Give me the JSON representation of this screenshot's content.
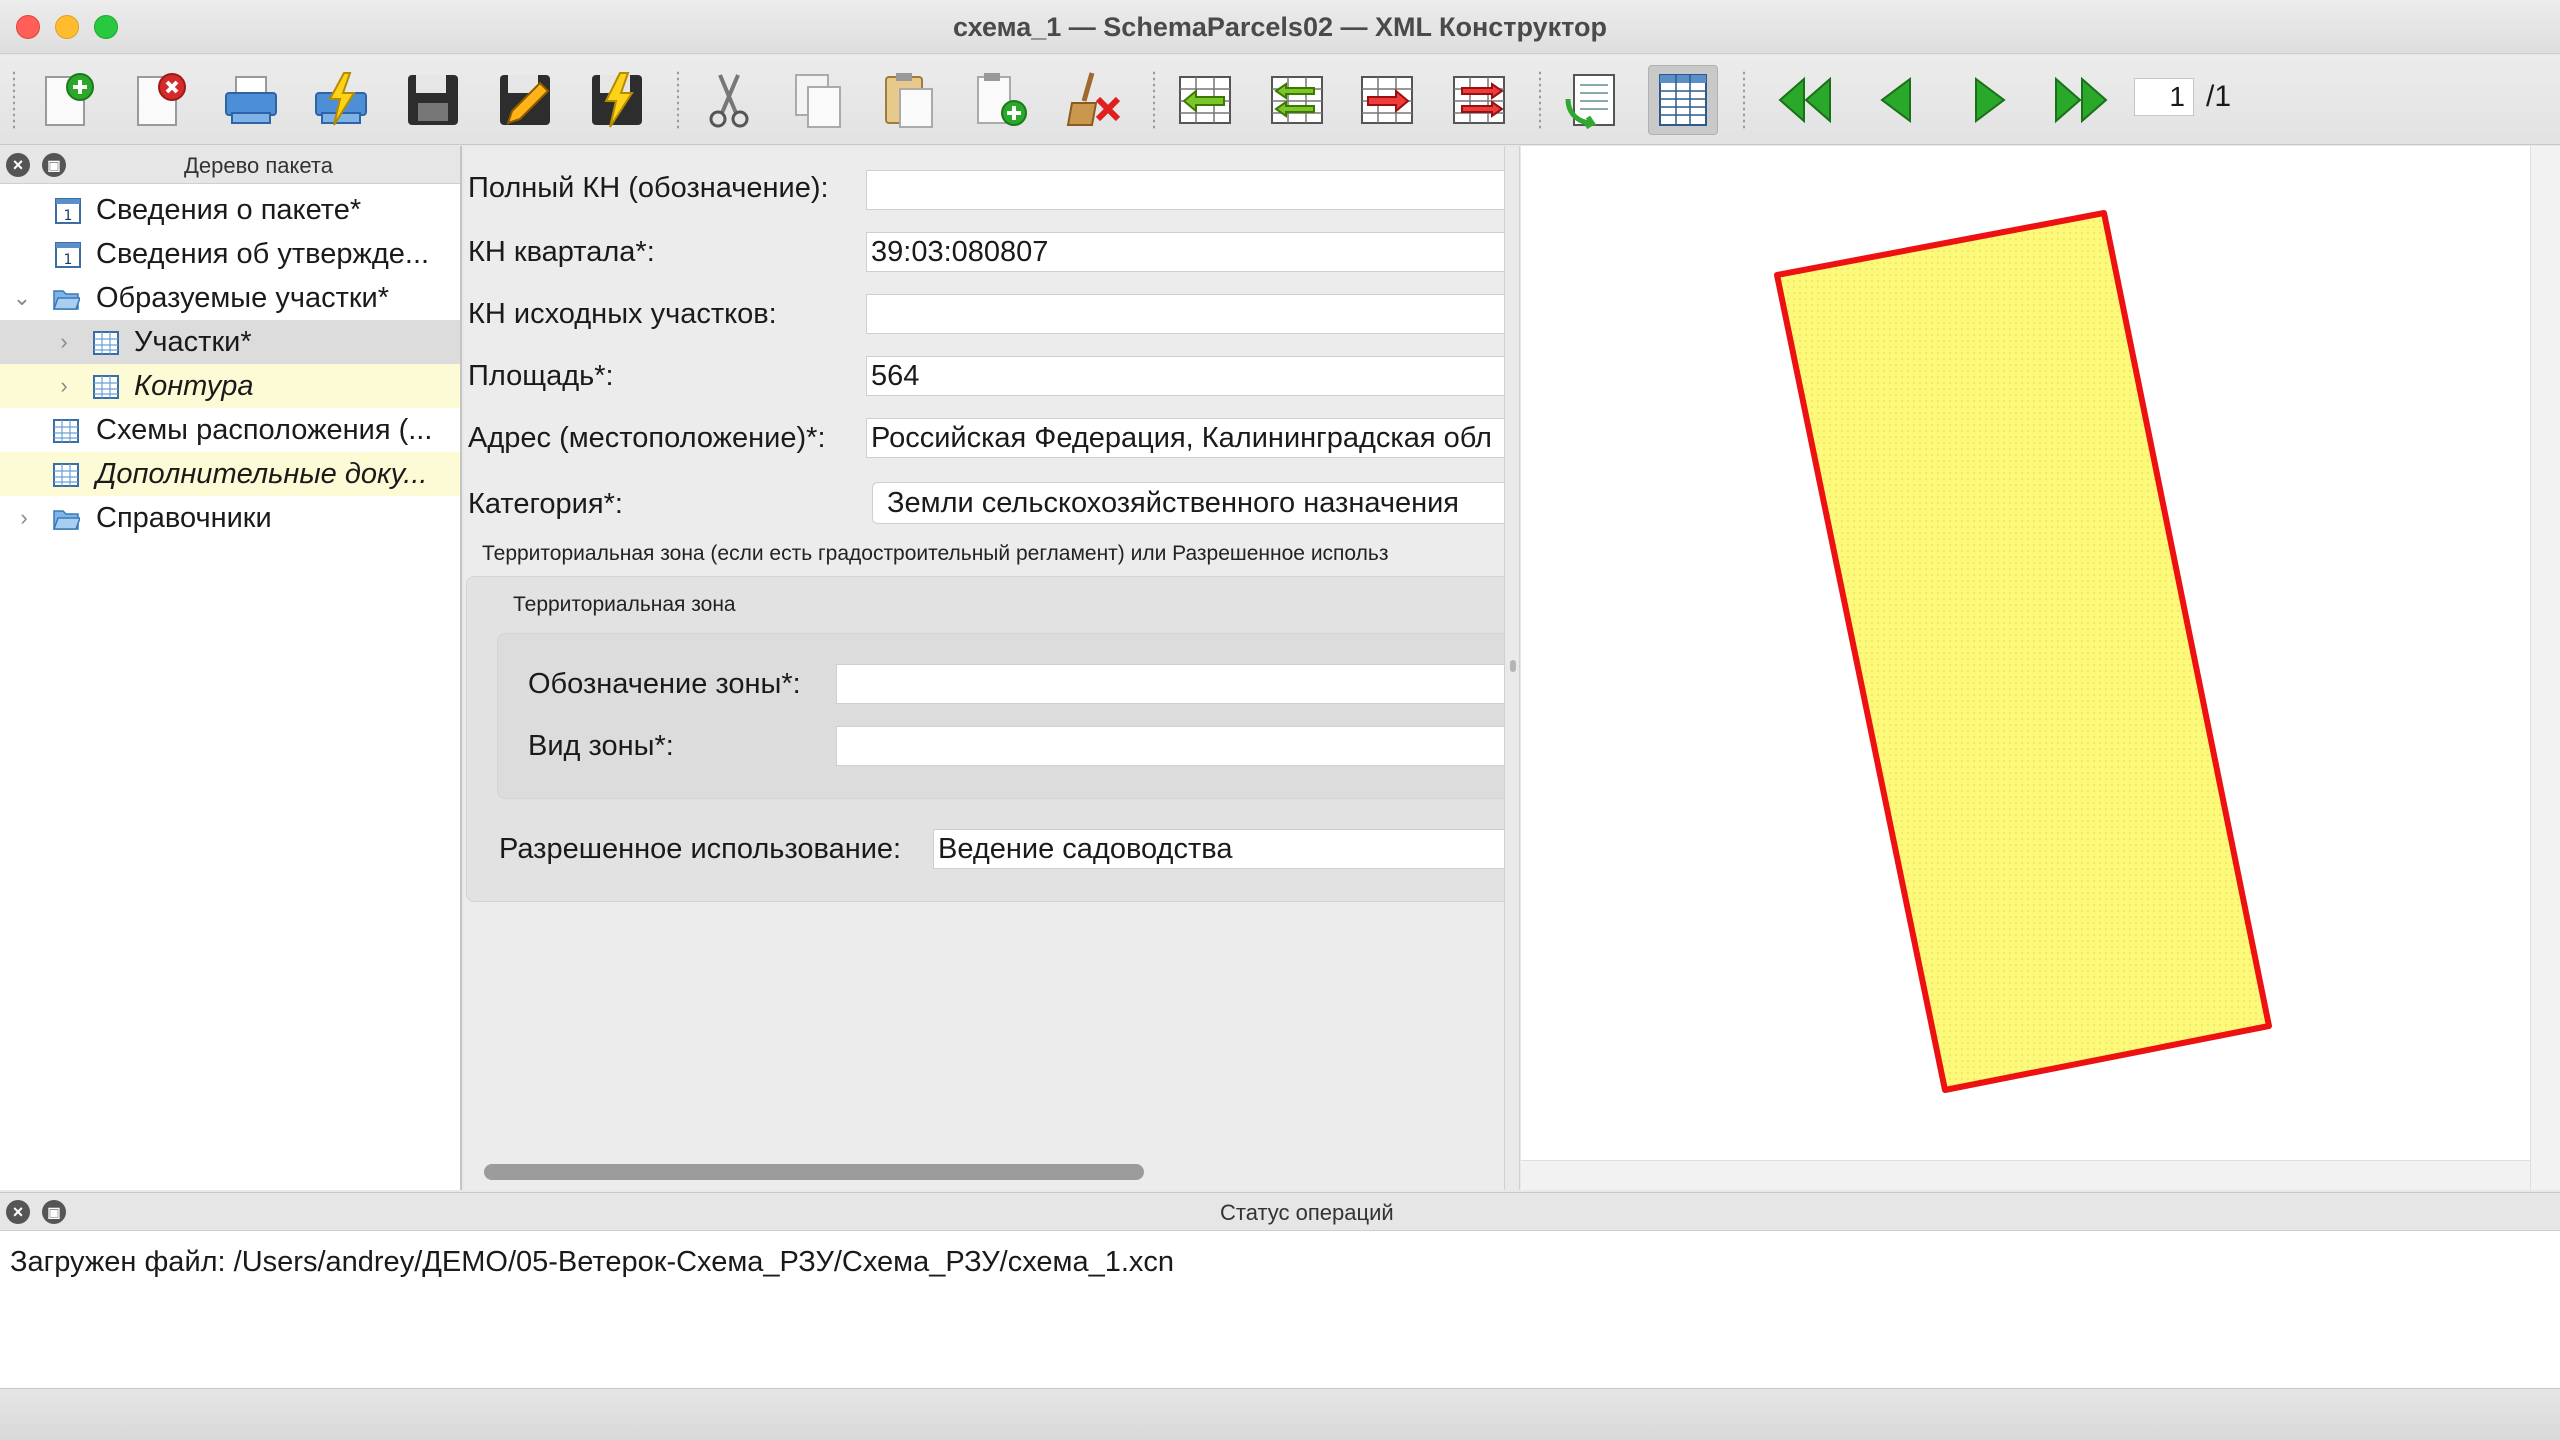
{
  "window": {
    "title": "схема_1 — SchemaParcels02 — XML Конструктор"
  },
  "toolbar": {
    "buttons": [
      {
        "name": "new-document",
        "icon": "new-doc-icon"
      },
      {
        "name": "close-document",
        "icon": "close-doc-icon"
      },
      {
        "name": "print",
        "icon": "printer-icon"
      },
      {
        "name": "quick-print",
        "icon": "printer-lightning-icon"
      },
      {
        "name": "save",
        "icon": "floppy-icon"
      },
      {
        "name": "save-as",
        "icon": "floppy-pencil-icon"
      },
      {
        "name": "quick-save",
        "icon": "floppy-lightning-icon"
      },
      {
        "name": "cut",
        "icon": "scissors-icon"
      },
      {
        "name": "copy",
        "icon": "copy-icon"
      },
      {
        "name": "paste",
        "icon": "paste-icon"
      },
      {
        "name": "paste-new",
        "icon": "paste-plus-icon"
      },
      {
        "name": "clear",
        "icon": "broom-icon"
      },
      {
        "name": "insert-row-before",
        "icon": "table-arrow-left-icon"
      },
      {
        "name": "insert-rows",
        "icon": "table-multi-arrow-left-icon"
      },
      {
        "name": "append-row",
        "icon": "table-arrow-right-icon"
      },
      {
        "name": "append-rows",
        "icon": "table-multi-arrow-right-icon"
      },
      {
        "name": "refresh-view",
        "icon": "doc-refresh-icon"
      },
      {
        "name": "table-view",
        "icon": "table-view-icon"
      },
      {
        "name": "first-page",
        "icon": "first-page-icon"
      },
      {
        "name": "prev-page",
        "icon": "prev-page-icon"
      },
      {
        "name": "next-page",
        "icon": "next-page-icon"
      },
      {
        "name": "last-page",
        "icon": "last-page-icon"
      }
    ],
    "page_current": "1",
    "page_total": "/1"
  },
  "tree": {
    "title": "Дерево пакета",
    "items": [
      {
        "label": "Сведения о пакете*"
      },
      {
        "label": "Сведения об утвержде..."
      },
      {
        "label": "Образуемые участки*"
      },
      {
        "label": "Участки*"
      },
      {
        "label": "Контура"
      },
      {
        "label": "Схемы расположения (..."
      },
      {
        "label": "Дополнительные доку..."
      },
      {
        "label": "Справочники"
      }
    ]
  },
  "form": {
    "full_kn_label": "Полный КН (обозначение):",
    "full_kn_value": "",
    "kn_quarter_label": "КН квартала*:",
    "kn_quarter_value": "39:03:080807",
    "kn_source_label": "КН исходных участков:",
    "kn_source_value": "",
    "area_label": "Площадь*:",
    "area_value": "564",
    "address_label": "Адрес (местоположение)*:",
    "address_value": "Российская Федерация, Калининградская обл",
    "category_label": "Категория*:",
    "category_value": "Земли сельскохозяйственного назначения",
    "outer_group_title": "Территориальная зона (если есть градостроительный регламент) или Разрешенное использ",
    "zone_group_title": "Территориальная зона",
    "zone_designation_label": "Обозначение зоны*:",
    "zone_designation_value": "",
    "zone_type_label": "Вид зоны*:",
    "zone_type_value": "",
    "permitted_use_label": "Разрешенное использование:",
    "permitted_use_value": "Ведение садоводства"
  },
  "map": {
    "parcel_fill": "#fdf97a",
    "parcel_stroke": "#ee1111"
  },
  "status": {
    "title": "Статус операций",
    "message": "Загружен файл: /Users/andrey/ДЕМО/05-Ветерок-Схема_РЗУ/Схема_РЗУ/схема_1.xcn"
  }
}
